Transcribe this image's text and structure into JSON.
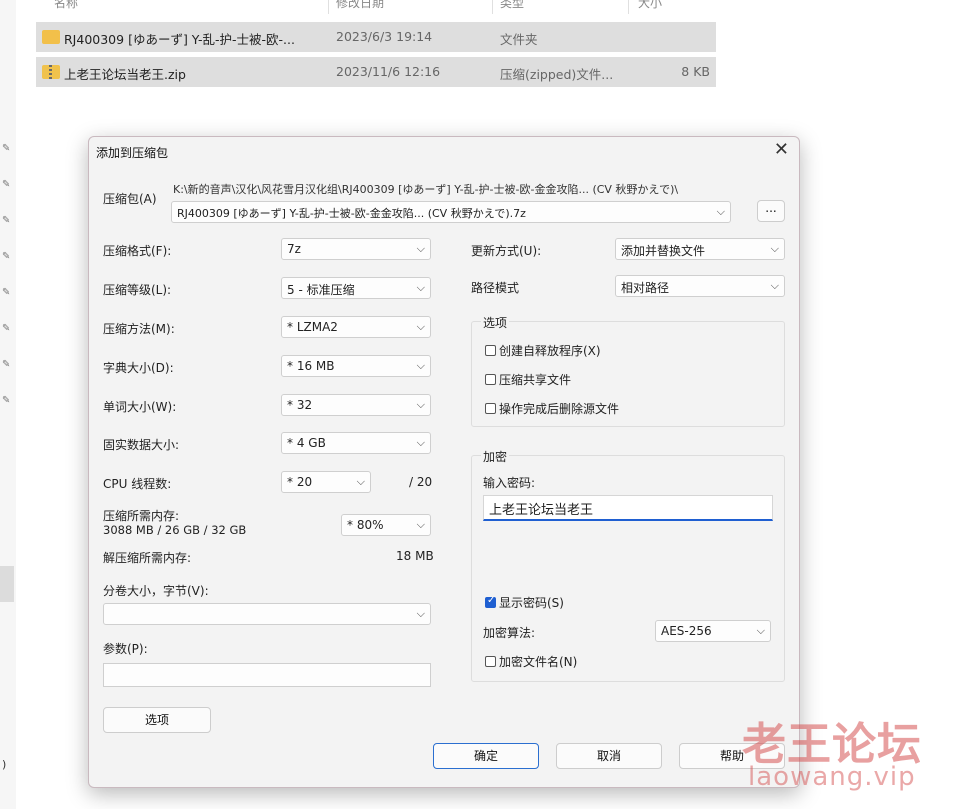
{
  "explorer": {
    "columns": [
      "名称",
      "修改日期",
      "类型",
      "大小"
    ],
    "files": [
      {
        "name": "RJ400309 [ゆあーず] Y-乱-护-士被-欧-...",
        "date": "2023/6/3 19:14",
        "type": "文件夹",
        "size": ""
      },
      {
        "name": "上老王论坛当老王.zip",
        "date": "2023/11/6 12:16",
        "type": "压缩(zipped)文件...",
        "size": "8 KB"
      }
    ],
    "left_paren": ")"
  },
  "dialog": {
    "title": "添加到压缩包",
    "close": "✕",
    "archive_label": "压缩包(A)",
    "archive_path": "K:\\新的音声\\汉化\\风花雪月汉化组\\RJ400309 [ゆあーず] Y-乱-护-士被-欧-金金攻陷... (CV 秋野かえで)\\",
    "archive_name": "RJ400309 [ゆあーず] Y-乱-护-士被-欧-金金攻陷... (CV 秋野かえで).7z",
    "browse_label": "...",
    "format_label": "压缩格式(F):",
    "format_value": "7z",
    "level_label": "压缩等级(L):",
    "level_value": "5 - 标准压缩",
    "method_label": "压缩方法(M):",
    "method_value": "* LZMA2",
    "dict_label": "字典大小(D):",
    "dict_value": "* 16 MB",
    "word_label": "单词大小(W):",
    "word_value": "* 32",
    "solid_label": "固实数据大小:",
    "solid_value": "* 4 GB",
    "threads_label": "CPU 线程数:",
    "threads_value": "* 20",
    "threads_max": "/ 20",
    "mem_label": "压缩所需内存:",
    "mem_detail": "3088 MB / 26 GB / 32 GB",
    "mem_value": "* 80%",
    "decomp_label": "解压缩所需内存:",
    "decomp_value": "18 MB",
    "volume_label": "分卷大小，字节(V):",
    "volume_value": "",
    "params_label": "参数(P):",
    "params_value": "",
    "options_button": "选项",
    "update_label": "更新方式(U):",
    "update_value": "添加并替换文件",
    "path_label": "路径模式",
    "path_value": "相对路径",
    "options_group": "选项",
    "opt_sfx": "创建自释放程序(X)",
    "opt_shared": "压缩共享文件",
    "opt_delete": "操作完成后删除源文件",
    "encrypt_group": "加密",
    "pwd_label": "输入密码:",
    "pwd_value": "上老王论坛当老王",
    "show_pwd": "显示密码(S)",
    "algo_label": "加密算法:",
    "algo_value": "AES-256",
    "encrypt_names": "加密文件名(N)",
    "ok": "确定",
    "cancel": "取消",
    "help": "帮助"
  },
  "watermark": {
    "text": "老王论坛",
    "url": "laowang.vip"
  }
}
